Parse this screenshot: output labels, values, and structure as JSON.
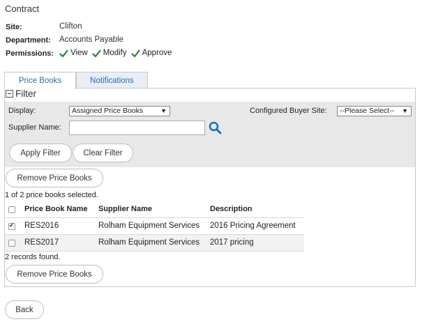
{
  "page": {
    "title": "Contract"
  },
  "info": {
    "site_label": "Site:",
    "site_value": "Clifton",
    "department_label": "Department:",
    "department_value": "Accounts Payable",
    "permissions_label": "Permissions:",
    "permissions": [
      "View",
      "Modify",
      "Approve"
    ]
  },
  "tabs": [
    {
      "label": "Price Books",
      "active": true
    },
    {
      "label": "Notifications",
      "active": false
    }
  ],
  "filter": {
    "heading": "Filter",
    "display_label": "Display:",
    "display_value": "Assigned Price Books",
    "buyer_site_label": "Configured Buyer Site:",
    "buyer_site_value": "--Please Select--",
    "supplier_label": "Supplier Name:",
    "supplier_value": "",
    "apply_label": "Apply Filter",
    "clear_label": "Clear Filter"
  },
  "actions": {
    "remove_label": "Remove Price Books"
  },
  "table": {
    "selection_status": "1 of 2 price books selected.",
    "headers": [
      "Price Book Name",
      "Supplier Name",
      "Description"
    ],
    "rows": [
      {
        "name": "RES2016",
        "supplier": "Rolham Equipment Services",
        "description": "2016 Pricing Agreement",
        "checked": true
      },
      {
        "name": "RES2017",
        "supplier": "Rolham Equipment Services",
        "description": "2017 pricing",
        "checked": false
      }
    ],
    "records_found": "2 records found."
  },
  "footer": {
    "back_label": "Back"
  },
  "colors": {
    "link": "#2a6db0",
    "check_green": "#2e7d32",
    "filter_bg": "#e8e8e8",
    "search_icon": "#1f6fbf"
  }
}
